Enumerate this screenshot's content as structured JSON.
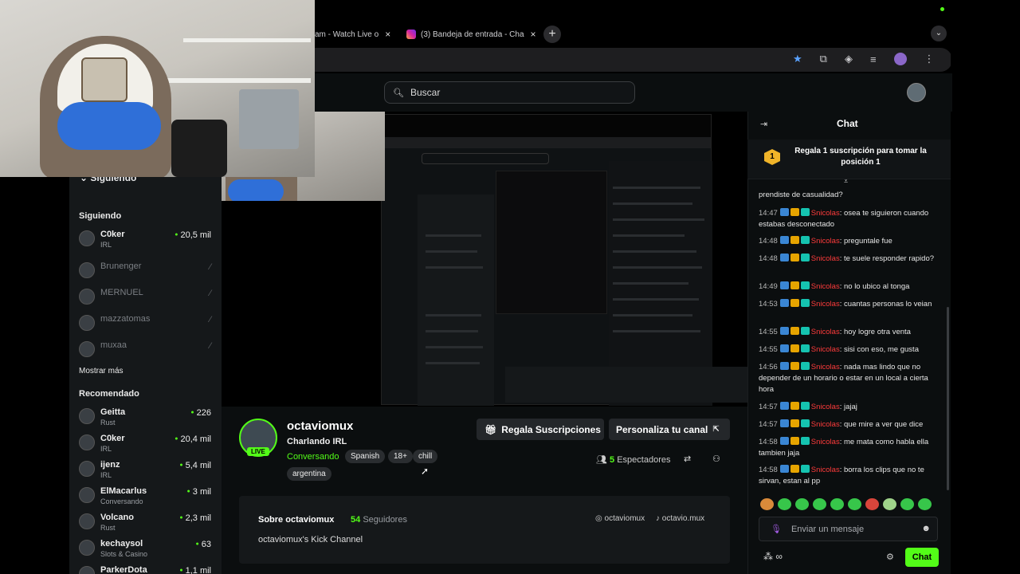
{
  "browser": {
    "tabs": [
      {
        "label": "am - Watch Live o",
        "close": "×"
      },
      {
        "label": "(3) Bandeja de entrada - Cha",
        "close": "×"
      }
    ],
    "new_tab": "+",
    "tab_menu": "⌄"
  },
  "header": {
    "search_placeholder": "Buscar"
  },
  "sidebar": {
    "heading": "Siguiendo",
    "following_title": "Siguiendo",
    "following": [
      {
        "name": "C0ker",
        "category": "IRL",
        "viewers": "20,5 mil",
        "live": true
      },
      {
        "name": "Brunenger",
        "category": "",
        "viewers": "⁄",
        "live": false
      },
      {
        "name": "MERNUEL",
        "category": "",
        "viewers": "⁄",
        "live": false
      },
      {
        "name": "mazzatomas",
        "category": "",
        "viewers": "⁄",
        "live": false
      },
      {
        "name": "muxaa",
        "category": "",
        "viewers": "⁄",
        "live": false
      }
    ],
    "show_more": "Mostrar más",
    "recommended_title": "Recomendado",
    "recommended": [
      {
        "name": "Geitta",
        "category": "Rust",
        "viewers": "226"
      },
      {
        "name": "C0ker",
        "category": "IRL",
        "viewers": "20,4 mil"
      },
      {
        "name": "ijenz",
        "category": "IRL",
        "viewers": "5,4 mil"
      },
      {
        "name": "ElMacarlus",
        "category": "Conversando",
        "viewers": "3 mil"
      },
      {
        "name": "Volcano",
        "category": "Rust",
        "viewers": "2,3 mil"
      },
      {
        "name": "kechaysol",
        "category": "Slots & Casino",
        "viewers": "63"
      },
      {
        "name": "ParkerDota",
        "category": "",
        "viewers": "1,1 mil"
      }
    ]
  },
  "channel": {
    "name": "octaviomux",
    "live": "LIVE",
    "stream_title": "Charlando IRL",
    "category": "Conversando",
    "tags": [
      "Spanish",
      "18+",
      "chill",
      "argentina"
    ],
    "gift_button": "Regala Suscripciones",
    "customize_button": "Personaliza tu canal",
    "viewers_count": "5",
    "viewers_label": "Espectadores"
  },
  "about": {
    "title": "Sobre octaviomux",
    "followers_count": "54",
    "followers_label": "Seguidores",
    "bio": "octaviomux's Kick Channel",
    "instagram": "octaviomux",
    "tiktok": "octavio.mux"
  },
  "chat": {
    "title": "Chat",
    "gift_rank": "1",
    "gift_text": "Regala 1 suscripción para tomar la posición 1",
    "pinned_tail": "prendiste de casualidad?",
    "messages": [
      {
        "time": "14:47",
        "user": "Snicolas",
        "text": "osea te siguieron cuando estabas desconectado"
      },
      {
        "time": "14:48",
        "user": "Snicolas",
        "text": "preguntale fue"
      },
      {
        "time": "14:48",
        "user": "Snicolas",
        "text": "te suele responder rapido?"
      },
      {
        "time": "14:49",
        "user": "Snicolas",
        "text": "no lo ubico al tonga"
      },
      {
        "time": "14:53",
        "user": "Snicolas",
        "text": "cuantas personas lo veian"
      },
      {
        "time": "14:55",
        "user": "Snicolas",
        "text": "hoy logre otra venta"
      },
      {
        "time": "14:55",
        "user": "Snicolas",
        "text": "sisi con eso, me gusta"
      },
      {
        "time": "14:56",
        "user": "Snicolas",
        "text": "nada mas lindo que no depender de un horario o estar en un local a cierta hora"
      },
      {
        "time": "14:57",
        "user": "Snicolas",
        "text": "jajaj"
      },
      {
        "time": "14:57",
        "user": "Snicolas",
        "text": "que mire a ver que dice"
      },
      {
        "time": "14:58",
        "user": "Snicolas",
        "text": "me mata como habla ella tambien jaja"
      },
      {
        "time": "14:58",
        "user": "Snicolas",
        "text": "borra los clips que no te sirvan, estan al pp"
      }
    ],
    "input_placeholder": "Enviar un mensaje",
    "points": "∞",
    "send_button": "Chat"
  }
}
